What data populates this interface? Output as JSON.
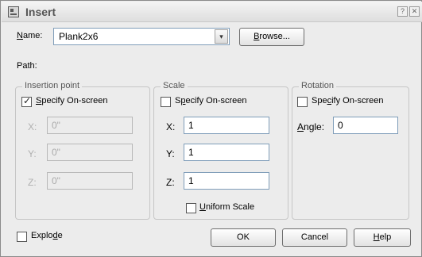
{
  "window": {
    "title": "Insert",
    "help_glyph": "?",
    "close_glyph": "✕"
  },
  "name_row": {
    "label_prefix": "N",
    "label_rest": "ame:",
    "value": "Plank2x6",
    "dropdown_glyph": "▾",
    "browse_prefix": "B",
    "browse_rest": "rowse..."
  },
  "path": {
    "label": "Path:"
  },
  "insertion_point": {
    "legend": "Insertion point",
    "specify_prefix": "S",
    "specify_rest": "pecify On-screen",
    "specify_checked": true,
    "fields": [
      {
        "label": "X:",
        "value": "0\""
      },
      {
        "label": "Y:",
        "value": "0\""
      },
      {
        "label": "Z:",
        "value": "0\""
      }
    ]
  },
  "scale": {
    "legend": "Scale",
    "specify_prefix": "S",
    "specify_mid": "p",
    "specify_rest": "ecify On-screen",
    "specify_checked": false,
    "fields": [
      {
        "label": "X:",
        "value": "1"
      },
      {
        "label": "Y:",
        "value": "1"
      },
      {
        "label": "Z:",
        "value": "1"
      }
    ],
    "uniform_prefix": "U",
    "uniform_rest": "niform Scale",
    "uniform_checked": false
  },
  "rotation": {
    "legend": "Rotation",
    "specify_a": "Spe",
    "specify_u": "c",
    "specify_b": "ify On-screen",
    "specify_checked": false,
    "angle_prefix": "A",
    "angle_rest": "ngle:",
    "angle_value": "0"
  },
  "explode": {
    "label_a": "Explo",
    "label_u": "d",
    "label_b": "e",
    "checked": false
  },
  "buttons": {
    "ok": "OK",
    "cancel": "Cancel",
    "help_prefix": "H",
    "help_rest": "elp"
  }
}
